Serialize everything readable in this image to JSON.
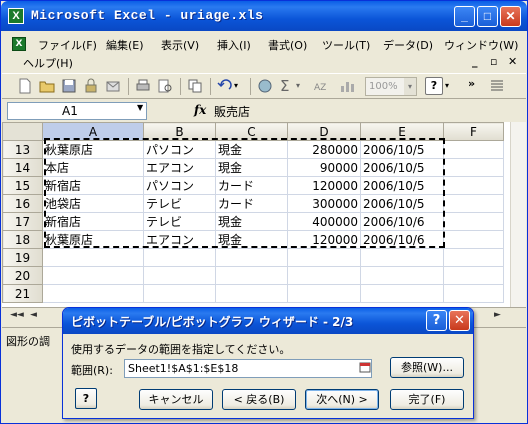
{
  "window": {
    "title": "Microsoft Excel - uriage.xls",
    "min_glyph": "_",
    "max_glyph": "□",
    "close_glyph": "✕"
  },
  "menu": {
    "items": [
      "ファイル(F)",
      "編集(E)",
      "表示(V)",
      "挿入(I)",
      "書式(O)",
      "ツール(T)",
      "データ(D)",
      "ウィンドウ(W)"
    ],
    "help": "ヘルプ(H)",
    "more": "»"
  },
  "toolbar": {
    "zoom": "100%",
    "help_glyph": "?"
  },
  "formula_bar": {
    "name_box": "A1",
    "fx": "fx",
    "content": "販売店"
  },
  "sheet": {
    "columns": [
      "A",
      "B",
      "C",
      "D",
      "E",
      "F"
    ],
    "rows": [
      {
        "n": "13",
        "a": "秋葉原店",
        "b": "パソコン",
        "c": "現金",
        "d": "280000",
        "e": "2006/10/5"
      },
      {
        "n": "14",
        "a": "本店",
        "b": "エアコン",
        "c": "現金",
        "d": "90000",
        "e": "2006/10/5"
      },
      {
        "n": "15",
        "a": "新宿店",
        "b": "パソコン",
        "c": "カード",
        "d": "120000",
        "e": "2006/10/5"
      },
      {
        "n": "16",
        "a": "池袋店",
        "b": "テレビ",
        "c": "カード",
        "d": "300000",
        "e": "2006/10/5"
      },
      {
        "n": "17",
        "a": "新宿店",
        "b": "テレビ",
        "c": "現金",
        "d": "400000",
        "e": "2006/10/6"
      },
      {
        "n": "18",
        "a": "秋葉原店",
        "b": "エアコン",
        "c": "現金",
        "d": "120000",
        "e": "2006/10/6"
      },
      {
        "n": "19",
        "a": "",
        "b": "",
        "c": "",
        "d": "",
        "e": ""
      },
      {
        "n": "20",
        "a": "",
        "b": "",
        "c": "",
        "d": "",
        "e": ""
      },
      {
        "n": "21",
        "a": "",
        "b": "",
        "c": "",
        "d": "",
        "e": ""
      }
    ]
  },
  "status": {
    "text": "図形の調"
  },
  "dialog": {
    "title": "ピボットテーブル/ピボットグラフ ウィザード - 2/3",
    "instruction": "使用するデータの範囲を指定してください。",
    "range_label": "範囲(R):",
    "range_value": "Sheet1!$A$1:$E$18",
    "ref_button": "参照(W)...",
    "help_button": "?",
    "cancel_button": "キャンセル",
    "back_button": "< 戻る(B)",
    "next_button": "次へ(N) >",
    "finish_button": "完了(F)",
    "help_glyph": "?",
    "close_glyph": "✕"
  }
}
